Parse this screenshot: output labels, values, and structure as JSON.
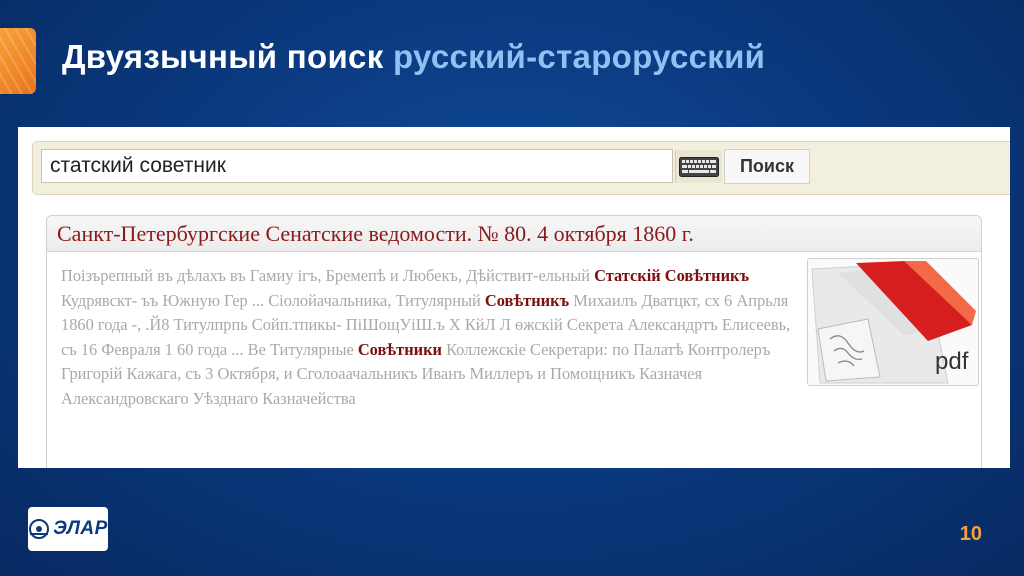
{
  "slide": {
    "title_main": "Двуязычный поиск",
    "title_highlight": "русский-старорусский",
    "page_number": "10",
    "logo_text": "ЭЛАР",
    "colors": {
      "background": "#0b3a80",
      "accent": "#f7a13c",
      "title_highlight": "#8fc1f2",
      "result_title": "#8a1a1a",
      "match": "#7a1010"
    }
  },
  "search": {
    "query": "статский советник",
    "keyboard_icon": "keyboard-icon",
    "button_label": "Поиск"
  },
  "result": {
    "title": "Санкт-Петербургские Сенатские ведомости. № 80. 4 октября 1860 г.",
    "snippet": [
      {
        "text": "Поізърепный въ дѣлахъ въ Гамиу ігъ, Бремепѣ и Любекъ, Дѣйствит-ельный ",
        "match": false
      },
      {
        "text": "Статскій Совѣтникъ",
        "match": true
      },
      {
        "text": " Кудрявскт- ъъ Южную Гер ... Сіолойачальника, Титулярный ",
        "match": false
      },
      {
        "text": "Совѣтникъ",
        "match": true
      },
      {
        "text": " Михаилъ Дватцкт, сх 6 Апрьля 1860 года -, .Й8 Титулпрпь Сойп.тпикы- ПіШощУіШ.ъ Х КйЛ Л ѳжскій Секрета Александртъ Елисеевь, съ 16 Февраля 1 60 года ... Ве Титулярные ",
        "match": false
      },
      {
        "text": "Совѣтники",
        "match": true
      },
      {
        "text": " Коллежскіе Секретари: по Палатѣ Контролеръ Григорій Кажага, съ 3 Октября, и Сголоаачальникъ Иванъ Миллеръ и Помощникъ Казначея Александровскаго Уѣзднаго Казначейства",
        "match": false
      }
    ],
    "thumbnail_label": "pdf",
    "thumbnail_icon": "pdf-icon"
  }
}
